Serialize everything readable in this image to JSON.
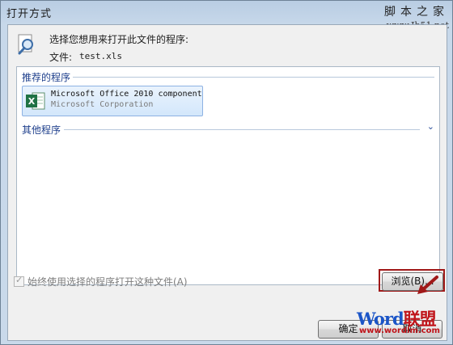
{
  "window": {
    "title": "打开方式"
  },
  "watermark_top": {
    "line1": "脚本之家",
    "line2": "www.Jb51.net"
  },
  "header": {
    "prompt": "选择您想用来打开此文件的程序:",
    "file_label": "文件:",
    "file_name": "test.xls"
  },
  "program_list": {
    "recommended_label": "推荐的程序",
    "other_label": "其他程序",
    "items": [
      {
        "name": "Microsoft Office 2010 component",
        "vendor": "Microsoft Corporation",
        "icon": "excel-icon"
      }
    ]
  },
  "options": {
    "always_use_label": "始终使用选择的程序打开这种文件(A)",
    "always_use_checked": true
  },
  "buttons": {
    "browse": "浏览(B)...",
    "ok": "确定",
    "cancel": "取消"
  },
  "watermark_bottom": {
    "brand_word": "Word",
    "brand_cn": "联盟",
    "url": "www.wordlm.com"
  },
  "colors": {
    "group_header": "#1e3f8c",
    "annotation_red": "#a01818",
    "excel_green": "#1f7244"
  }
}
